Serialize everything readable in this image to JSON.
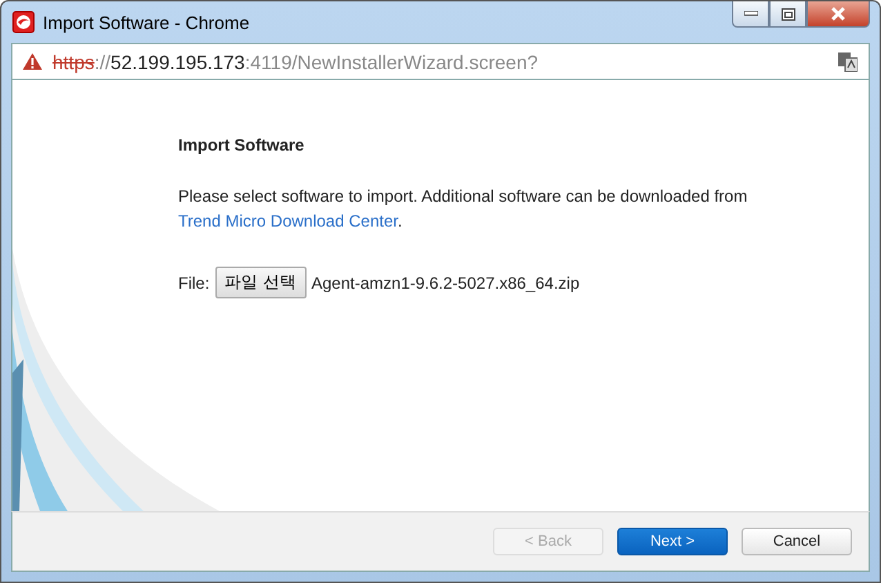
{
  "window": {
    "title": "Import Software - Chrome"
  },
  "address_bar": {
    "insecure": true,
    "scheme": "https",
    "separator": "://",
    "host": "52.199.195.173",
    "rest": ":4119/NewInstallerWizard.screen?"
  },
  "page": {
    "heading": "Import Software",
    "intro": "Please select software to import. Additional software can be downloaded from",
    "link": "Trend Micro Download Center",
    "link_end": ".",
    "file": {
      "label": "File:",
      "button": "파일 선택",
      "value": "Agent-amzn1-9.6.2-5027.x86_64.zip"
    }
  },
  "buttons": [
    {
      "label": "< Back",
      "kind": "default",
      "disabled": true
    },
    {
      "label": "Next >",
      "kind": "primary",
      "disabled": false
    },
    {
      "label": "Cancel",
      "kind": "default",
      "disabled": false
    }
  ]
}
